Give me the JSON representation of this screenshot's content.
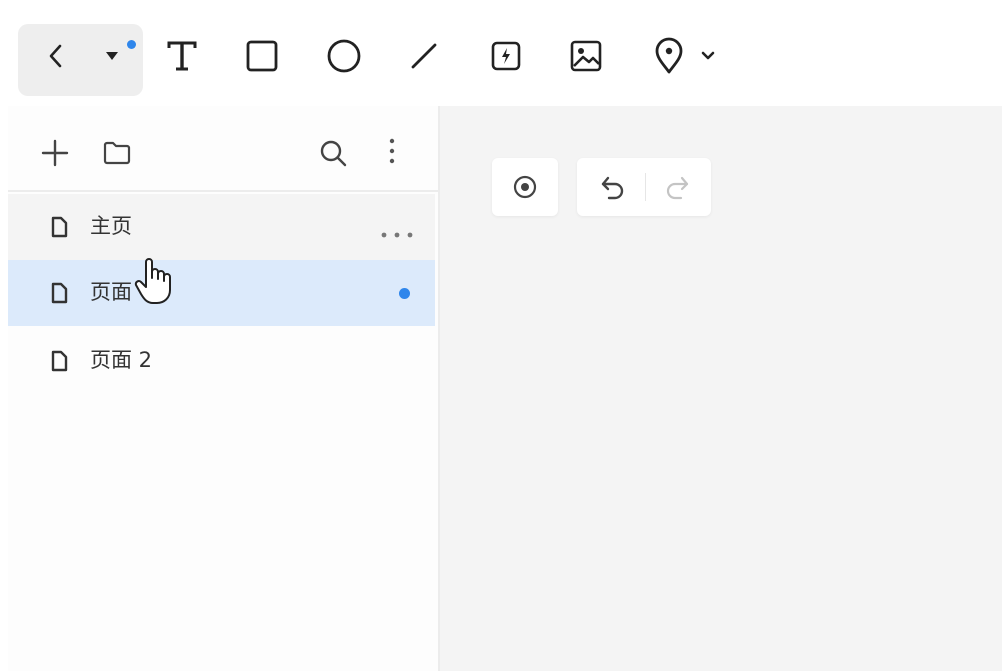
{
  "toolbar": {
    "tools": [
      {
        "name": "back-icon"
      },
      {
        "name": "dropdown-caret-icon"
      },
      {
        "name": "text-icon"
      },
      {
        "name": "rectangle-icon"
      },
      {
        "name": "ellipse-icon"
      },
      {
        "name": "line-icon"
      },
      {
        "name": "flash-frame-icon"
      },
      {
        "name": "image-icon"
      },
      {
        "name": "location-pin-icon"
      },
      {
        "name": "chevron-down-icon"
      }
    ],
    "accent": "#2f86eb"
  },
  "sidebar": {
    "header_icons": [
      "plus-icon",
      "folder-icon",
      "search-icon",
      "vertical-dots-icon"
    ],
    "pages": [
      {
        "label": "主页",
        "selected": false,
        "hover": true
      },
      {
        "label": "页面",
        "selected": true,
        "hover": false
      },
      {
        "label": "页面 2",
        "selected": false,
        "hover": false
      }
    ],
    "selected_bg": "#dceafb",
    "hover_bg": "#f4f4f4"
  },
  "canvas": {
    "controls": [
      "target-icon",
      "undo-icon",
      "redo-icon"
    ],
    "background": "#f4f4f4"
  }
}
